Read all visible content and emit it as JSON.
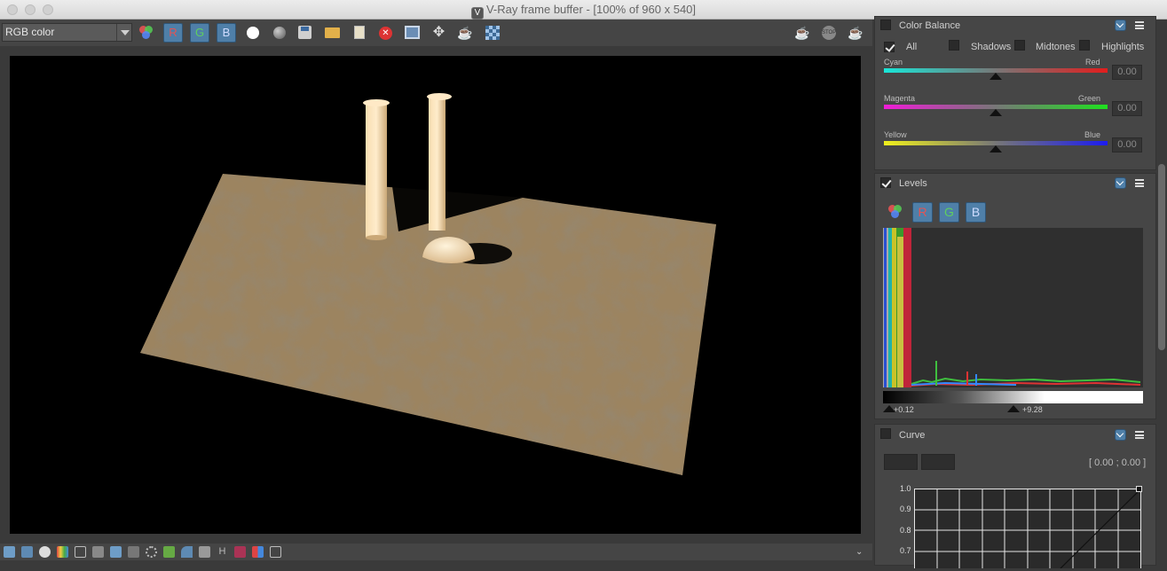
{
  "window": {
    "title": "V-Ray frame buffer - [100% of 960 x 540]"
  },
  "toolbar": {
    "channel_select": "RGB color",
    "r_label": "R",
    "g_label": "G",
    "b_label": "B"
  },
  "color_balance": {
    "title": "Color Balance",
    "options": [
      "All",
      "Shadows",
      "Midtones",
      "Highlights"
    ],
    "cyan": "Cyan",
    "red": "Red",
    "magenta": "Magenta",
    "green": "Green",
    "yellow": "Yellow",
    "blue": "Blue",
    "cyan_red_value": "0.00",
    "magenta_green_value": "0.00",
    "yellow_blue_value": "0.00"
  },
  "levels": {
    "title": "Levels",
    "r_label": "R",
    "g_label": "G",
    "b_label": "B",
    "min_value": "+0.12",
    "max_value": "+9.28"
  },
  "curve": {
    "title": "Curve",
    "coords": "[ 0.00 ; 0.00 ]",
    "y_ticks": [
      "1.0",
      "0.9",
      "0.8",
      "0.7"
    ]
  },
  "colors": {
    "accent": "#4f7fa8",
    "panel": "#464646",
    "viewport": "#000000"
  }
}
